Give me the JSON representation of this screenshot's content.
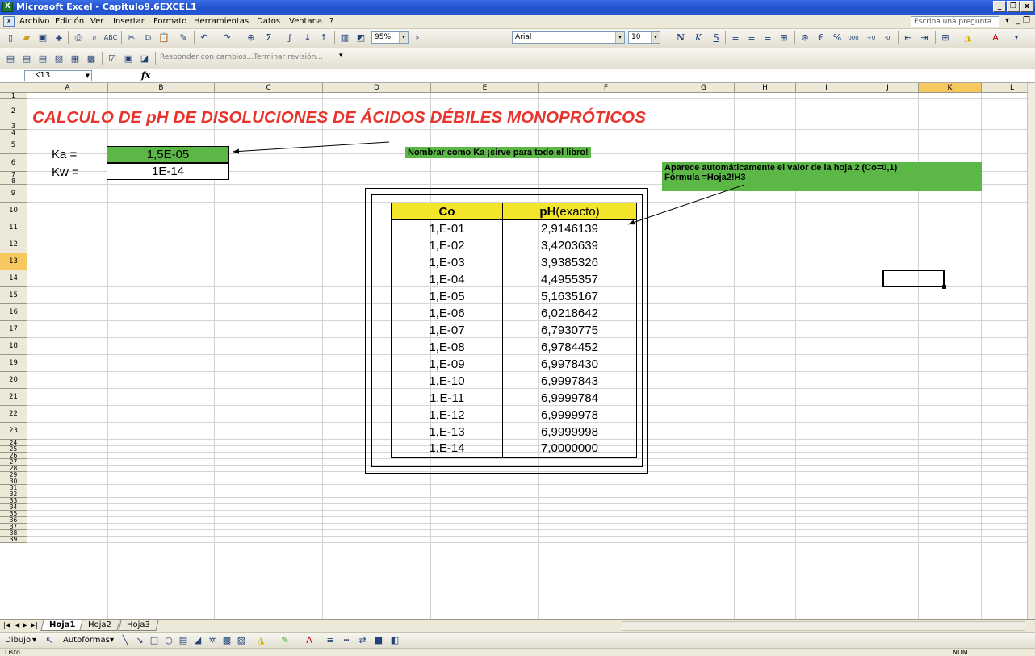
{
  "window": {
    "title": "Microsoft Excel - Capitulo9.6EXCEL1",
    "buttons": [
      "_",
      "❐",
      "x"
    ]
  },
  "menu": {
    "items": [
      "Archivo",
      "Edición",
      "Ver",
      "Insertar",
      "Formato",
      "Herramientas",
      "Datos",
      "Ventana",
      "?"
    ],
    "help_placeholder": "Escriba una pregunta"
  },
  "toolbar": {
    "zoom": "95%",
    "font": "Arial",
    "size": "10"
  },
  "review_toolbar": {
    "reply_label": "Responder con cambios...",
    "end_label": "Terminar revisión..."
  },
  "formula_bar": {
    "name_box": "K13",
    "fx": "fx",
    "value": ""
  },
  "columns": [
    "A",
    "B",
    "C",
    "D",
    "E",
    "F",
    "G",
    "H",
    "I",
    "J",
    "K",
    "L"
  ],
  "selected_column": "K",
  "selected_row": "13",
  "rows": [
    "1",
    "2",
    "3",
    "4",
    "5",
    "6",
    "7",
    "8",
    "9",
    "10",
    "11",
    "12",
    "13",
    "14",
    "15",
    "16",
    "17",
    "18",
    "19",
    "20",
    "21",
    "22",
    "23",
    "24",
    "25",
    "26",
    "27",
    "28",
    "29",
    "30",
    "31",
    "32",
    "33",
    "34",
    "35",
    "36",
    "37",
    "38",
    "39"
  ],
  "sheet": {
    "title": "CALCULO DE pH DE DISOLUCIONES DE ÁCIDOS DÉBILES MONOPRÓTICOS",
    "ka_label": "Ka =",
    "ka_value": "1,5E-05",
    "kw_label": "Kw =",
    "kw_value": "1E-14",
    "note_ka": "Nombrar como Ka ¡sirve para todo el libro!",
    "note_auto_line1": "Aparece automáticamente el valor de la hoja 2 (Co=0,1)",
    "note_auto_line2": "Fórmula =Hoja2!H3",
    "table_header_co": "Co",
    "table_header_ph_bold": "pH",
    "table_header_ph_rest": "(exacto)",
    "table_rows": [
      {
        "co": "1,E-01",
        "ph": "2,9146139"
      },
      {
        "co": "1,E-02",
        "ph": "3,4203639"
      },
      {
        "co": "1,E-03",
        "ph": "3,9385326"
      },
      {
        "co": "1,E-04",
        "ph": "4,4955357"
      },
      {
        "co": "1,E-05",
        "ph": "5,1635167"
      },
      {
        "co": "1,E-06",
        "ph": "6,0218642"
      },
      {
        "co": "1,E-07",
        "ph": "6,7930775"
      },
      {
        "co": "1,E-08",
        "ph": "6,9784452"
      },
      {
        "co": "1,E-09",
        "ph": "6,9978430"
      },
      {
        "co": "1,E-10",
        "ph": "6,9997843"
      },
      {
        "co": "1,E-11",
        "ph": "6,9999784"
      },
      {
        "co": "1,E-12",
        "ph": "6,9999978"
      },
      {
        "co": "1,E-13",
        "ph": "6,9999998"
      },
      {
        "co": "1,E-14",
        "ph": "7,0000000"
      }
    ]
  },
  "sheet_tabs": [
    "Hoja1",
    "Hoja2",
    "Hoja3"
  ],
  "active_tab": "Hoja1",
  "draw_toolbar": {
    "draw_label": "Dibujo",
    "autoshapes_label": "Autoformas"
  },
  "status": {
    "left": "Listo",
    "right": "NUM"
  },
  "colors": {
    "title_red": "#e8342c",
    "note_green": "#5bb847",
    "header_yellow": "#f3e52a",
    "selection_orange": "#f6c85f"
  }
}
